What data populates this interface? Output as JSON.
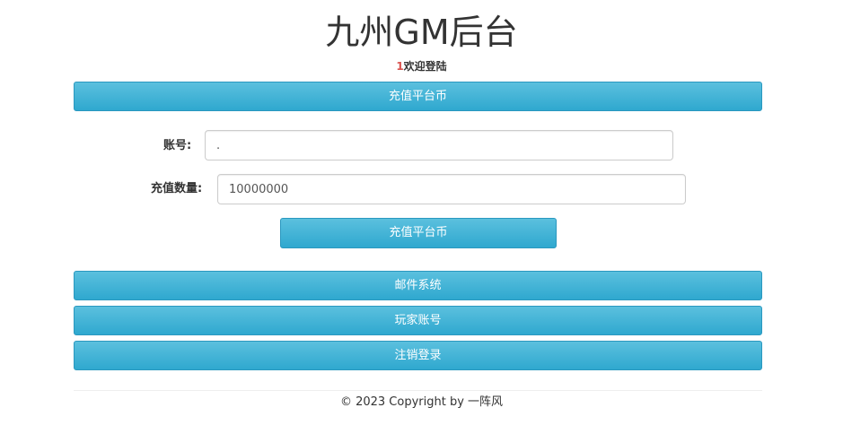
{
  "header": {
    "title": "九州GM后台",
    "welcome_number": "1",
    "welcome_text": "欢迎登陆"
  },
  "section_header": {
    "label": "充值平台币"
  },
  "form": {
    "account_label": "账号:",
    "account_value": ".",
    "amount_label": "充值数量:",
    "amount_value": "10000000",
    "submit_label": "充值平台币"
  },
  "nav": {
    "mail_label": "邮件系统",
    "player_account_label": "玩家账号",
    "logout_label": "注销登录"
  },
  "footer": {
    "copyright": "© 2023 Copyright by 一阵风"
  },
  "colors": {
    "button_top": "#5bc0de",
    "button_bottom": "#2fa8cf",
    "button_border": "#2a98bf",
    "welcome_number": "#d9534f"
  }
}
